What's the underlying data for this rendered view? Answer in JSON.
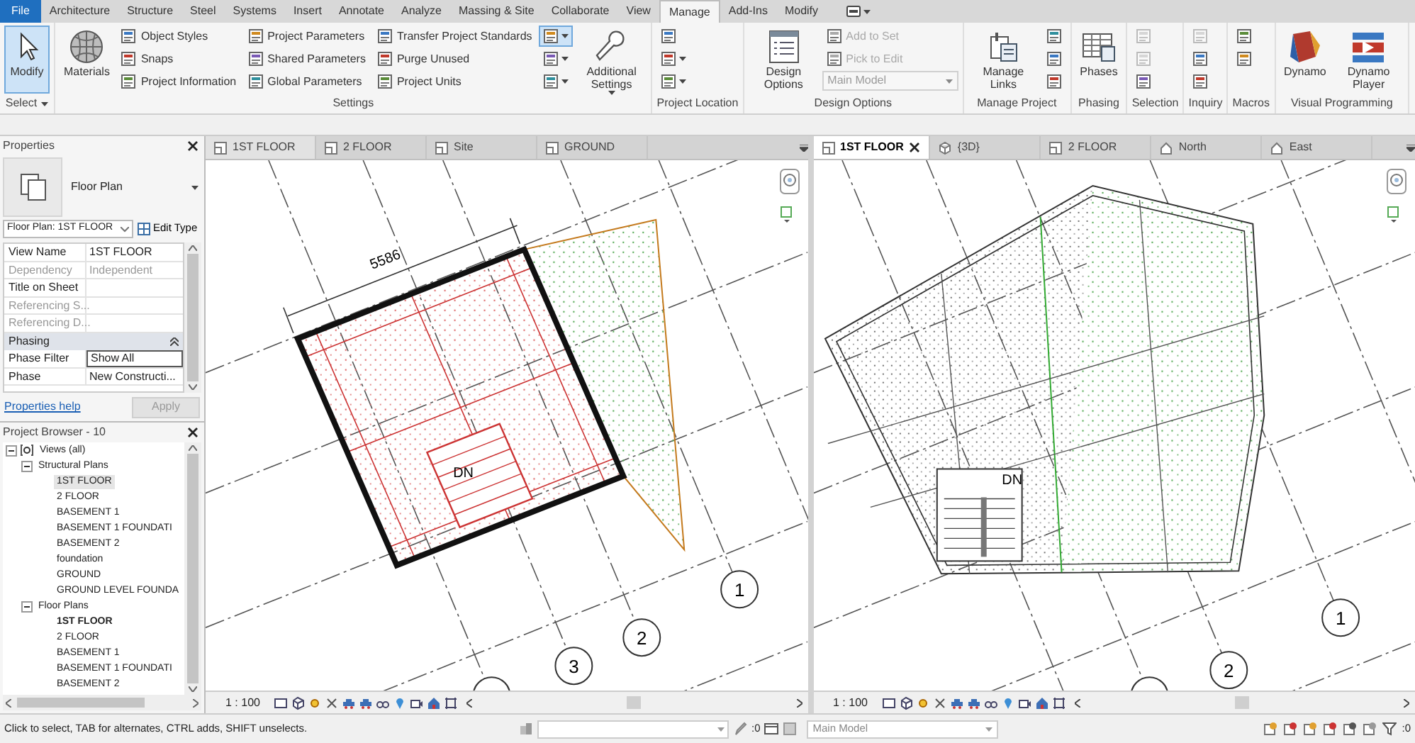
{
  "ribbon_tabs": [
    {
      "label": "File",
      "kind": "application",
      "selected": false
    },
    {
      "label": "Architecture",
      "kind": "tab",
      "selected": false
    },
    {
      "label": "Structure",
      "kind": "tab",
      "selected": false
    },
    {
      "label": "Steel",
      "kind": "tab",
      "selected": false
    },
    {
      "label": "Systems",
      "kind": "tab",
      "selected": false
    },
    {
      "label": "Insert",
      "kind": "tab",
      "selected": false
    },
    {
      "label": "Annotate",
      "kind": "tab",
      "selected": false
    },
    {
      "label": "Analyze",
      "kind": "tab",
      "selected": false
    },
    {
      "label": "Massing & Site",
      "kind": "tab",
      "selected": false
    },
    {
      "label": "Collaborate",
      "kind": "tab",
      "selected": false
    },
    {
      "label": "View",
      "kind": "tab",
      "selected": false
    },
    {
      "label": "Manage",
      "kind": "tab",
      "selected": true
    },
    {
      "label": "Add-Ins",
      "kind": "tab",
      "selected": false
    },
    {
      "label": "Modify",
      "kind": "tab",
      "selected": false
    }
  ],
  "ribbon_panels": [
    {
      "label": "Select",
      "menu": true,
      "items": [
        {
          "kind": "large",
          "label": "Modify",
          "selected": true
        }
      ]
    },
    {
      "label": "Settings",
      "items": [
        {
          "kind": "large",
          "label": "Materials",
          "selected": false
        },
        {
          "kind": "stack",
          "buttons": [
            {
              "label": "Object Styles"
            },
            {
              "label": "Snaps"
            },
            {
              "label": "Project Information"
            }
          ]
        },
        {
          "kind": "stack",
          "buttons": [
            {
              "label": "Project Parameters"
            },
            {
              "label": "Shared Parameters"
            },
            {
              "label": "Global Parameters"
            }
          ]
        },
        {
          "kind": "stack",
          "buttons": [
            {
              "label": "Transfer Project Standards"
            },
            {
              "label": "Purge Unused"
            },
            {
              "label": "Project Units"
            }
          ]
        },
        {
          "kind": "icons",
          "buttons": [
            {
              "selected": true,
              "menu": true
            },
            {
              "selected": false,
              "menu": true
            },
            {
              "selected": false,
              "menu": true
            }
          ]
        },
        {
          "kind": "large",
          "label": "Additional Settings",
          "selected": false,
          "menu": true
        }
      ]
    },
    {
      "label": "Project Location",
      "items": [
        {
          "kind": "icons",
          "buttons": [
            {
              "menu": false
            },
            {
              "menu": true
            },
            {
              "menu": true
            }
          ]
        }
      ]
    },
    {
      "label": "Design Options",
      "items": [
        {
          "kind": "large",
          "label": "Design Options",
          "selected": false
        },
        {
          "kind": "stack",
          "buttons": [
            {
              "kind": "button",
              "label": "Add to Set",
              "disabled": true
            },
            {
              "kind": "button",
              "label": "Pick to Edit",
              "disabled": true
            },
            {
              "kind": "combo",
              "value": "Main Model",
              "disabled": true
            }
          ]
        }
      ]
    },
    {
      "label": "Manage Project",
      "items": [
        {
          "kind": "large",
          "label": "Manage Links",
          "selected": false
        },
        {
          "kind": "icons",
          "buttons": [
            {
              "disabled": false
            },
            {
              "disabled": false
            },
            {
              "disabled": false
            }
          ]
        }
      ]
    },
    {
      "label": "Phasing",
      "items": [
        {
          "kind": "large",
          "label": "Phases",
          "selected": false
        }
      ]
    },
    {
      "label": "Selection",
      "items": [
        {
          "kind": "icons",
          "buttons": [
            {
              "disabled": true
            },
            {
              "disabled": true
            },
            {
              "disabled": false
            }
          ]
        }
      ]
    },
    {
      "label": "Inquiry",
      "items": [
        {
          "kind": "icons",
          "buttons": [
            {
              "disabled": true
            },
            {
              "disabled": false
            },
            {
              "disabled": false
            }
          ]
        }
      ]
    },
    {
      "label": "Macros",
      "items": [
        {
          "kind": "icons",
          "buttons": [
            {
              "disabled": false
            },
            {
              "disabled": false
            }
          ]
        }
      ]
    },
    {
      "label": "Visual Programming",
      "items": [
        {
          "kind": "large",
          "label": "Dynamo",
          "selected": false
        },
        {
          "kind": "large",
          "label": "Dynamo Player",
          "selected": false
        }
      ]
    }
  ],
  "properties": {
    "title": "Properties",
    "type_name": "Floor Plan",
    "instance_selector": "Floor Plan: 1ST FLOOR",
    "edit_type": "Edit Type",
    "rows": [
      {
        "kind": "param",
        "name": "View Name",
        "value": "1ST FLOOR",
        "disabled": false,
        "editing": false
      },
      {
        "kind": "param",
        "name": "Dependency",
        "value": "Independent",
        "disabled": true,
        "editing": false
      },
      {
        "kind": "param",
        "name": "Title on Sheet",
        "disabled": false,
        "editing": false
      },
      {
        "kind": "param",
        "name": "Referencing S...",
        "disabled": true,
        "editing": false
      },
      {
        "kind": "param",
        "name": "Referencing D...",
        "disabled": true,
        "editing": false
      },
      {
        "kind": "group",
        "name": "Phasing",
        "expanded": true
      },
      {
        "kind": "param",
        "name": "Phase Filter",
        "value": "Show All",
        "disabled": false,
        "editing": true
      },
      {
        "kind": "param",
        "name": "Phase",
        "value": "New Constructi...",
        "disabled": false,
        "editing": false
      }
    ],
    "help_link": "Properties help",
    "apply": {
      "label": "Apply",
      "disabled": true
    }
  },
  "project_browser": {
    "title": "Project Browser - 10",
    "tree": [
      {
        "label": "Views (all)",
        "expanded": true,
        "selected": false,
        "children": [
          {
            "label": "Structural Plans",
            "expanded": true,
            "selected": false,
            "children": [
              {
                "label": "1ST FLOOR",
                "selected": true,
                "current": false
              },
              {
                "label": "2 FLOOR",
                "selected": false,
                "current": false
              },
              {
                "label": "BASEMENT 1",
                "selected": false,
                "current": false
              },
              {
                "label": "BASEMENT 1 FOUNDATI",
                "selected": false,
                "current": false
              },
              {
                "label": "BASEMENT 2",
                "selected": false,
                "current": false
              },
              {
                "label": "foundation",
                "selected": false,
                "current": false
              },
              {
                "label": "GROUND",
                "selected": false,
                "current": false
              },
              {
                "label": "GROUND LEVEL FOUNDA",
                "selected": false,
                "current": false
              }
            ]
          },
          {
            "label": "Floor Plans",
            "expanded": true,
            "selected": false,
            "children": [
              {
                "label": "1ST FLOOR",
                "selected": false,
                "current": true
              },
              {
                "label": "2 FLOOR",
                "selected": false,
                "current": false
              },
              {
                "label": "BASEMENT 1",
                "selected": false,
                "current": false
              },
              {
                "label": "BASEMENT 1 FOUNDATI",
                "selected": false,
                "current": false
              },
              {
                "label": "BASEMENT 2",
                "selected": false,
                "current": false
              }
            ]
          }
        ]
      }
    ]
  },
  "views": [
    {
      "active": false,
      "tabs": [
        {
          "label": "1ST FLOOR",
          "kind": "plan",
          "selected": true
        },
        {
          "label": "2 FLOOR",
          "kind": "plan",
          "selected": false
        },
        {
          "label": "Site",
          "kind": "plan",
          "selected": false
        },
        {
          "label": "GROUND",
          "kind": "plan",
          "selected": false
        }
      ],
      "dimension": "5586",
      "stair_label": "DN",
      "grid_bubbles": [
        "1",
        "2",
        "3"
      ],
      "scale": "1 : 100"
    },
    {
      "active": true,
      "tabs": [
        {
          "label": "1ST FLOOR",
          "kind": "plan",
          "selected": true
        },
        {
          "label": "{3D}",
          "kind": "model",
          "selected": false
        },
        {
          "label": "2 FLOOR",
          "kind": "plan",
          "selected": false
        },
        {
          "label": "North",
          "kind": "elevation",
          "selected": false
        },
        {
          "label": "East",
          "kind": "elevation",
          "selected": false
        }
      ],
      "stair_label": "DN",
      "grid_bubbles": [
        "1",
        "2"
      ],
      "scale": "1 : 100"
    }
  ],
  "status_bar": {
    "message": "Click to select, TAB for alternates, CTRL adds, SHIFT unselects.",
    "editable_count": ":0",
    "design_option": "Main Model",
    "filter_count": ":0"
  }
}
